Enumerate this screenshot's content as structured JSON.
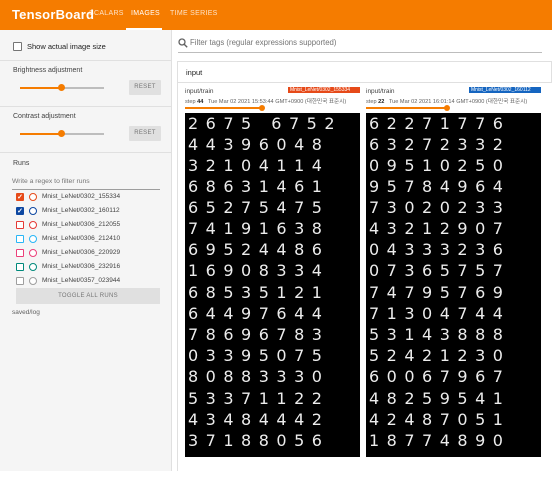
{
  "header": {
    "brand": "TensorBoard",
    "tabs": [
      {
        "label": "SCALARS",
        "active": false
      },
      {
        "label": "IMAGES",
        "active": true
      },
      {
        "label": "TIME SERIES",
        "active": false
      }
    ],
    "accent": "#f57c00"
  },
  "sidebar": {
    "show_actual_size": {
      "label": "Show actual image size",
      "checked": false
    },
    "brightness": {
      "label": "Brightness adjustment",
      "reset": "RESET",
      "level": 0.5
    },
    "contrast": {
      "label": "Contrast adjustment",
      "reset": "RESET",
      "level": 0.5
    },
    "runs": {
      "title": "Runs",
      "filter_placeholder": "Write a regex to filter runs",
      "items": [
        {
          "name": "Mnist_LeNet/0302_155334",
          "color": "#e64a19",
          "checked": true
        },
        {
          "name": "Mnist_LeNet/0302_160112",
          "color": "#0d47a1",
          "checked": true
        },
        {
          "name": "Mnist_LeNet/0306_212055",
          "color": "#e53935",
          "checked": false
        },
        {
          "name": "Mnist_LeNet/0306_212410",
          "color": "#29b6f6",
          "checked": false
        },
        {
          "name": "Mnist_LeNet/0306_220929",
          "color": "#ec407a",
          "checked": false
        },
        {
          "name": "Mnist_LeNet/0306_232916",
          "color": "#00897b",
          "checked": false
        },
        {
          "name": "Mnist_LeNet/0357_023944",
          "color": "#9e9e9e",
          "checked": false
        }
      ],
      "toggle_all": "TOGGLE ALL RUNS",
      "log_dir": "saved/log"
    }
  },
  "main": {
    "search_placeholder": "Filter tags (regular expressions supported)",
    "group_title": "input",
    "cards": [
      {
        "tag": "input/train",
        "run_chip": "Mnist_LeNet/0302_155334",
        "run_color": "#e64a19",
        "step_label": "step",
        "step": "44",
        "timestamp": "Tue Mar 02 2021 15:53:44 GMT+0900 (대한민국 표준시)",
        "digit_rows": [
          "2675 6752",
          "44396048",
          "32104114",
          "68631461",
          "65275475",
          "74191638",
          "69524486",
          "16908334",
          "68535121",
          "64497644",
          "78696783",
          "03395075",
          "80883330",
          "53371122",
          "43484442",
          "37188056"
        ]
      },
      {
        "tag": "input/train",
        "run_chip": "Mnist_LeNet/0302_160112",
        "run_color": "#1565c0",
        "step_label": "step",
        "step": "22",
        "timestamp": "Tue Mar 02 2021 16:01:14 GMT+0900 (대한민국 표준시)",
        "digit_rows": [
          "62271776",
          "63272332",
          "09510250",
          "95784964",
          "73020233",
          "43212907",
          "04333236",
          "07365757",
          "74795769",
          "71304744",
          "53143888",
          "52421230",
          "60067967",
          "48259541",
          "42487051",
          "18774890"
        ]
      }
    ]
  }
}
